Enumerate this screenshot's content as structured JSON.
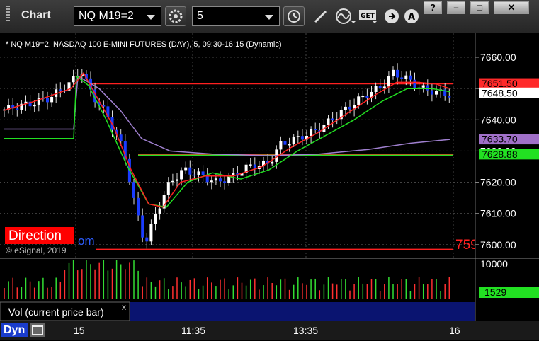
{
  "window": {
    "title": "Chart"
  },
  "toolbar": {
    "symbol": "NQ M19=2",
    "interval": "5"
  },
  "window_controls": {
    "help": "?",
    "minimize": "–",
    "maximize": "□",
    "close": "✕"
  },
  "chart": {
    "header": "* NQ M19=2, NASDAQ 100 E-MINI FUTURES (DAY), 5, 09:30-16:15 (Dynamic)",
    "copyright": "© eSignal, 2019",
    "direction_label": "Direction",
    "direction_tail": "om",
    "edge_value": "759",
    "price_axis": [
      "7660.00",
      "7650.00",
      "7640.00",
      "7630.00",
      "7620.00",
      "7610.00",
      "7600.00"
    ],
    "price_labels": [
      {
        "text": "7651.50",
        "bg": "#ff2a2a",
        "fg": "#000000"
      },
      {
        "text": "7648.50",
        "bg": "#ffffff",
        "fg": "#000000"
      },
      {
        "text": "7633.70",
        "bg": "#a070c8",
        "fg": "#000000"
      },
      {
        "text": "7628.88",
        "bg": "#22e022",
        "fg": "#000000"
      }
    ],
    "time_axis": [
      "15",
      "11:35",
      "13:35",
      "16"
    ],
    "volume_axis": [
      "10000"
    ],
    "volume_label": "1529",
    "volume_panel_label": "Vol (current price bar)",
    "close_glyph": "x",
    "mode_label": "Dyn"
  },
  "chart_data": {
    "type": "candlestick",
    "ylim": [
      7597,
      7665
    ],
    "levels": [
      7651.5,
      7628.88,
      7598.5
    ]
  },
  "colors": {
    "up": "#ffffff",
    "down": "#1a3cff",
    "ema_red": "#ff2020",
    "ema_green": "#22e022",
    "sma_purple": "#a080d0"
  }
}
